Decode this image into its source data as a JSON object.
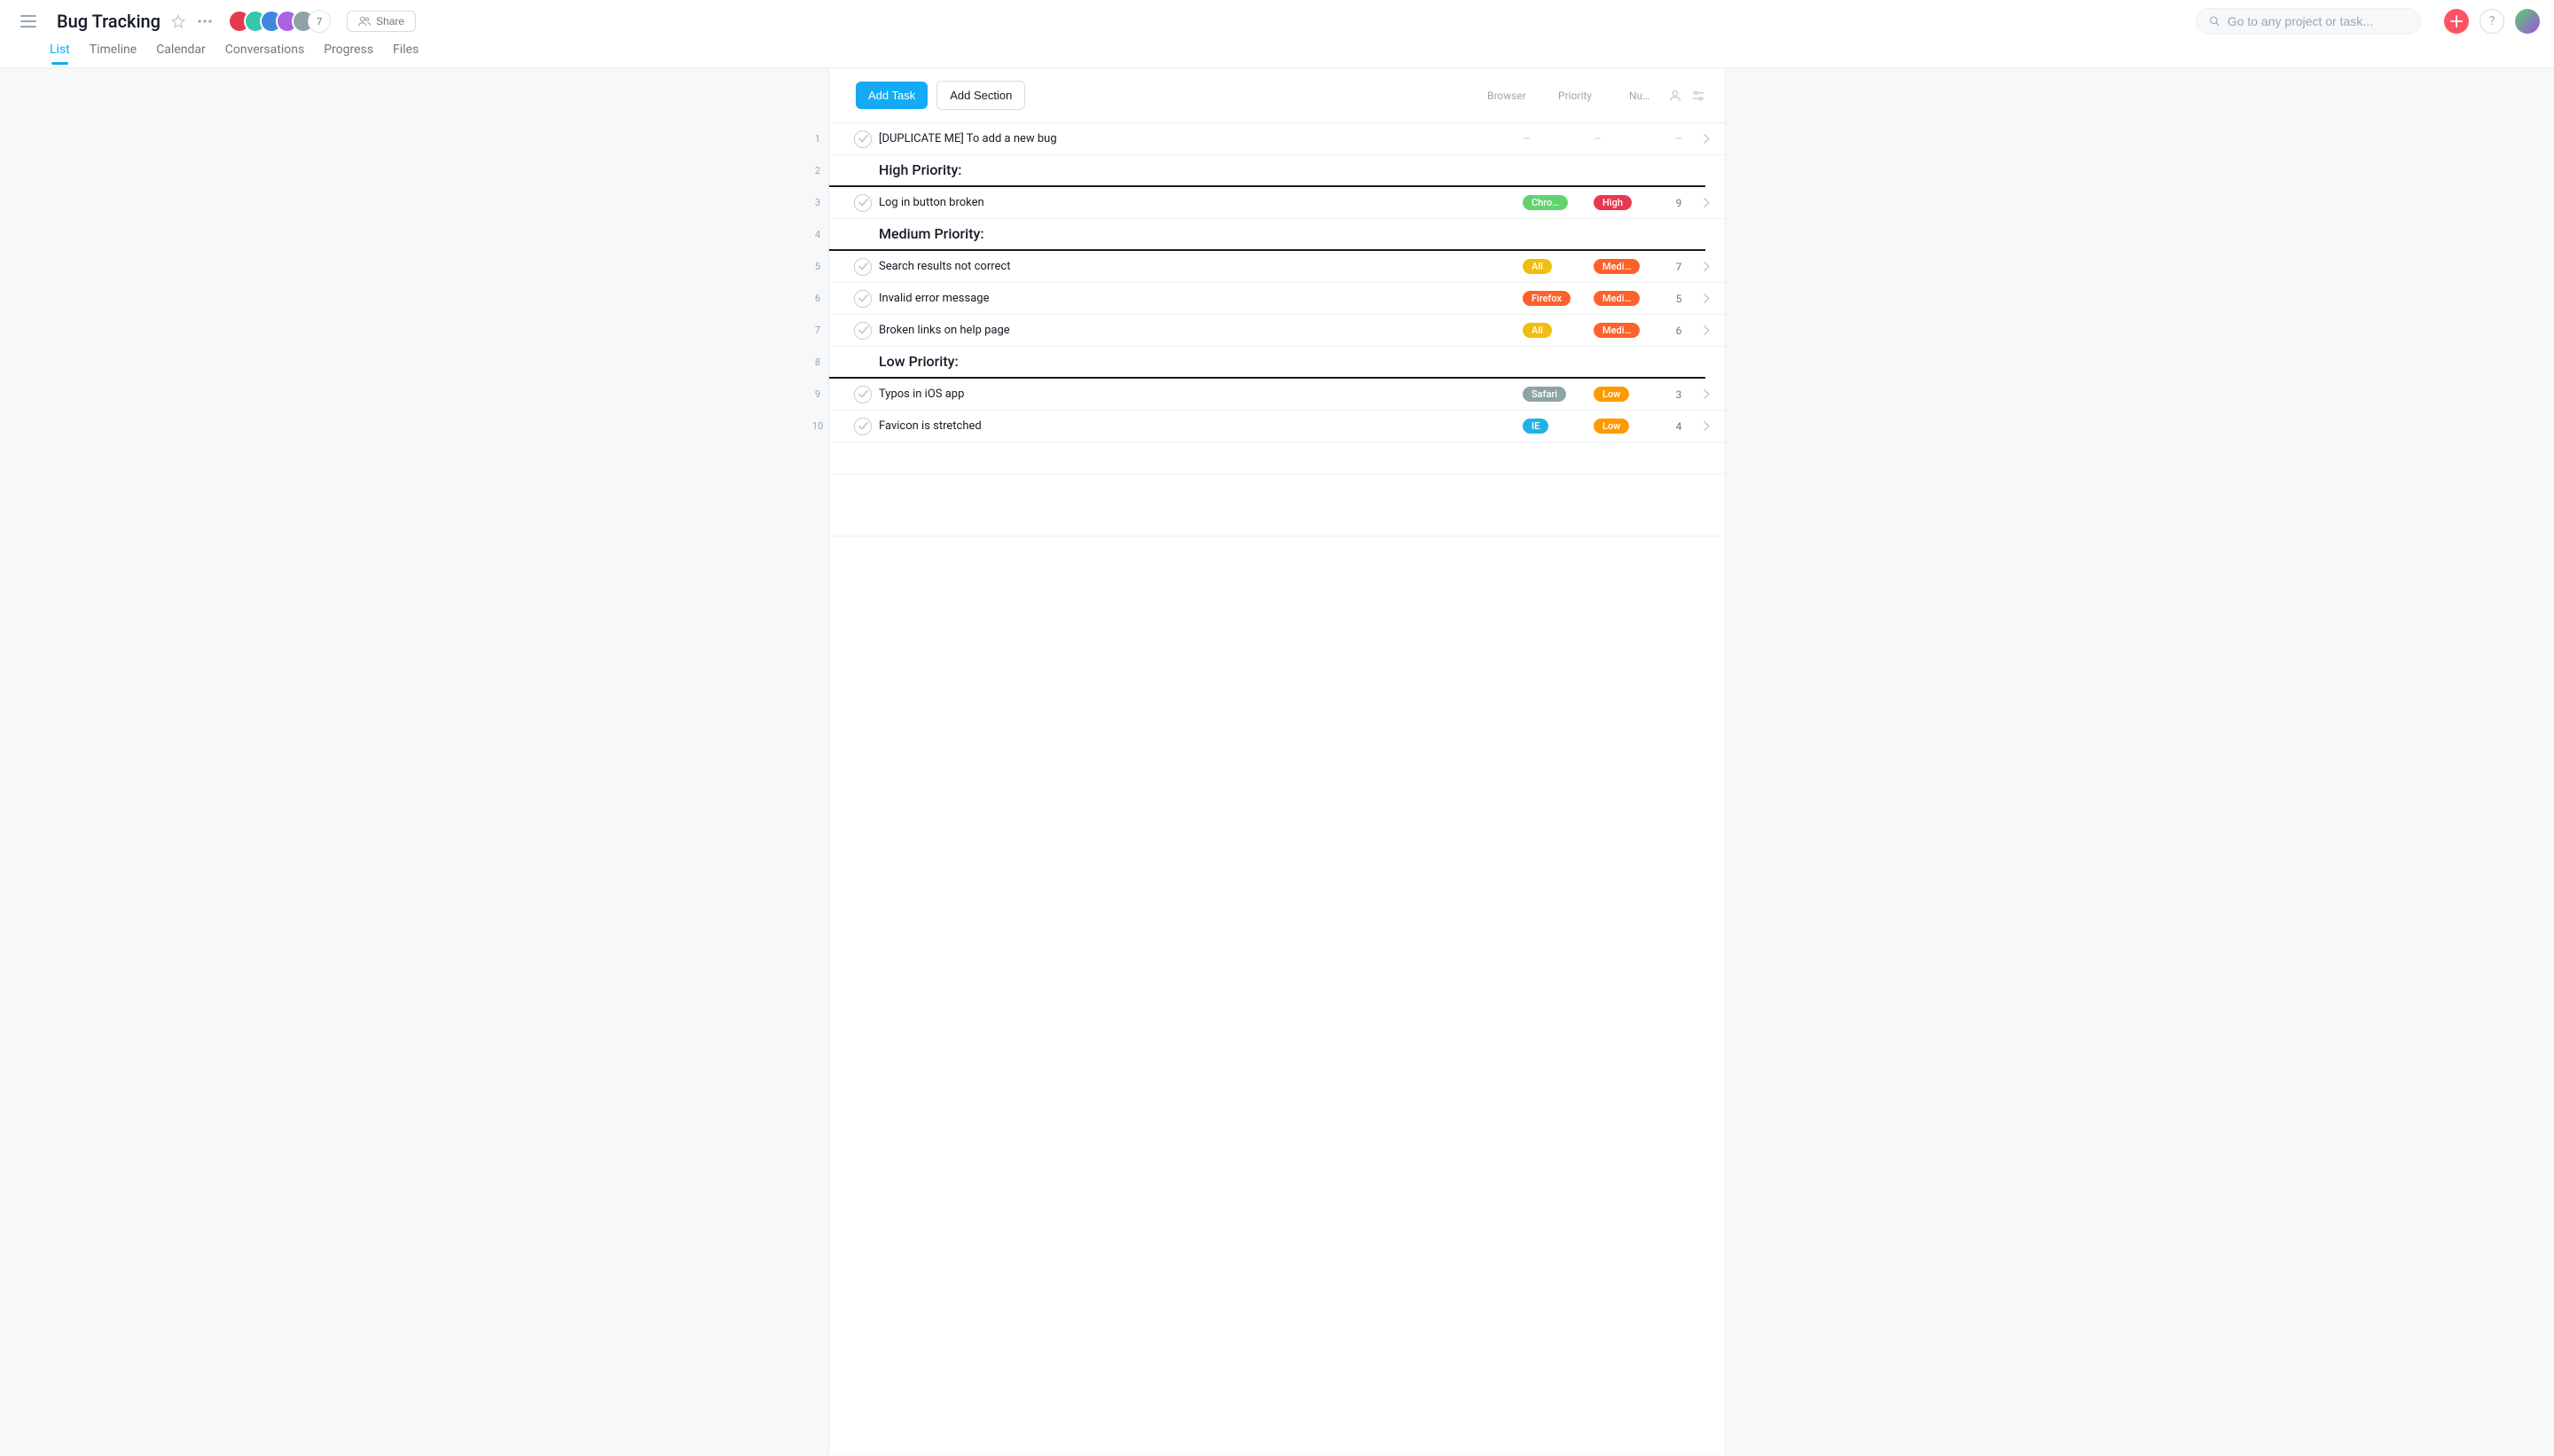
{
  "header": {
    "title": "Bug Tracking",
    "avatar_colors": [
      "#e8384f",
      "#37c5ab",
      "#4186e0",
      "#aa62e3",
      "#8da3a6"
    ],
    "avatar_plus": "7",
    "share_label": "Share"
  },
  "search": {
    "placeholder": "Go to any project or task..."
  },
  "tabs": [
    "List",
    "Timeline",
    "Calendar",
    "Conversations",
    "Progress",
    "Files"
  ],
  "active_tab": 0,
  "toolbar": {
    "add_task_label": "Add Task",
    "add_section_label": "Add Section",
    "columns": {
      "browser": "Browser",
      "priority": "Priority",
      "number": "Num…"
    }
  },
  "pill_colors": {
    "browser": {
      "Chrome": "#62d26f",
      "All": "#f1bd12",
      "Firefox": "#fd612c",
      "Safari": "#8da3a6",
      "IE": "#22b1e7"
    },
    "priority": {
      "High": "#e8384f",
      "Medium": "#fd612c",
      "Low": "#fd9a00"
    }
  },
  "rows": [
    {
      "n": "1",
      "type": "task",
      "title": "[DUPLICATE ME] To add a new bug",
      "browser": null,
      "browser_display": null,
      "priority": null,
      "priority_display": null,
      "number": null
    },
    {
      "n": "2",
      "type": "section",
      "title": "High Priority:"
    },
    {
      "n": "3",
      "type": "task",
      "title": "Log in button broken",
      "browser": "Chrome",
      "browser_display": "Chro…",
      "priority": "High",
      "priority_display": "High",
      "number": "9"
    },
    {
      "n": "4",
      "type": "section",
      "title": "Medium Priority:"
    },
    {
      "n": "5",
      "type": "task",
      "title": "Search results not correct",
      "browser": "All",
      "browser_display": "All",
      "priority": "Medium",
      "priority_display": "Medi…",
      "number": "7"
    },
    {
      "n": "6",
      "type": "task",
      "title": "Invalid error message",
      "browser": "Firefox",
      "browser_display": "Firefox",
      "priority": "Medium",
      "priority_display": "Medi…",
      "number": "5"
    },
    {
      "n": "7",
      "type": "task",
      "title": "Broken links on help page",
      "browser": "All",
      "browser_display": "All",
      "priority": "Medium",
      "priority_display": "Medi…",
      "number": "6"
    },
    {
      "n": "8",
      "type": "section",
      "title": "Low Priority:"
    },
    {
      "n": "9",
      "type": "task",
      "title": "Typos in iOS app",
      "browser": "Safari",
      "browser_display": "Safari",
      "priority": "Low",
      "priority_display": "Low",
      "number": "3"
    },
    {
      "n": "10",
      "type": "task",
      "title": "Favicon is stretched",
      "browser": "IE",
      "browser_display": "IE",
      "priority": "Low",
      "priority_display": "Low",
      "number": "4"
    }
  ]
}
